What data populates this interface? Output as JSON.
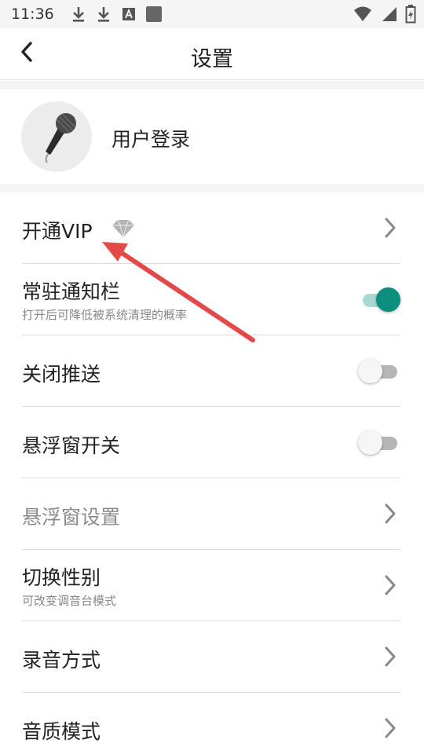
{
  "status_bar": {
    "time": "11:36",
    "icons": [
      "download-icon",
      "download-icon",
      "keyboard-a-icon",
      "app-square-icon",
      "wifi-icon",
      "signal-icon",
      "battery-icon"
    ]
  },
  "header": {
    "title": "设置",
    "back_icon": "chevron-left-icon"
  },
  "user": {
    "login_label": "用户登录",
    "avatar_icon": "microphone-icon"
  },
  "settings": {
    "vip": {
      "title": "开通VIP",
      "badge_icon": "diamond-icon",
      "chevron_icon": "chevron-right-icon"
    },
    "notification_bar": {
      "title": "常驻通知栏",
      "subtitle": "打开后可降低被系统清理的概率",
      "enabled": true
    },
    "close_push": {
      "title": "关闭推送",
      "enabled": false
    },
    "floating_window_switch": {
      "title": "悬浮窗开关",
      "enabled": false
    },
    "floating_window_settings": {
      "title": "悬浮窗设置",
      "disabled": true
    },
    "switch_gender": {
      "title": "切换性别",
      "subtitle": "可改变调音台模式"
    },
    "recording_mode": {
      "title": "录音方式"
    },
    "audio_quality": {
      "title": "音质模式"
    }
  },
  "colors": {
    "accent": "#0d8f80",
    "accent_track": "#a9d8d2",
    "annotation_arrow": "#e24a48",
    "divider": "#dcdcdc",
    "band": "#f4f4f4"
  }
}
